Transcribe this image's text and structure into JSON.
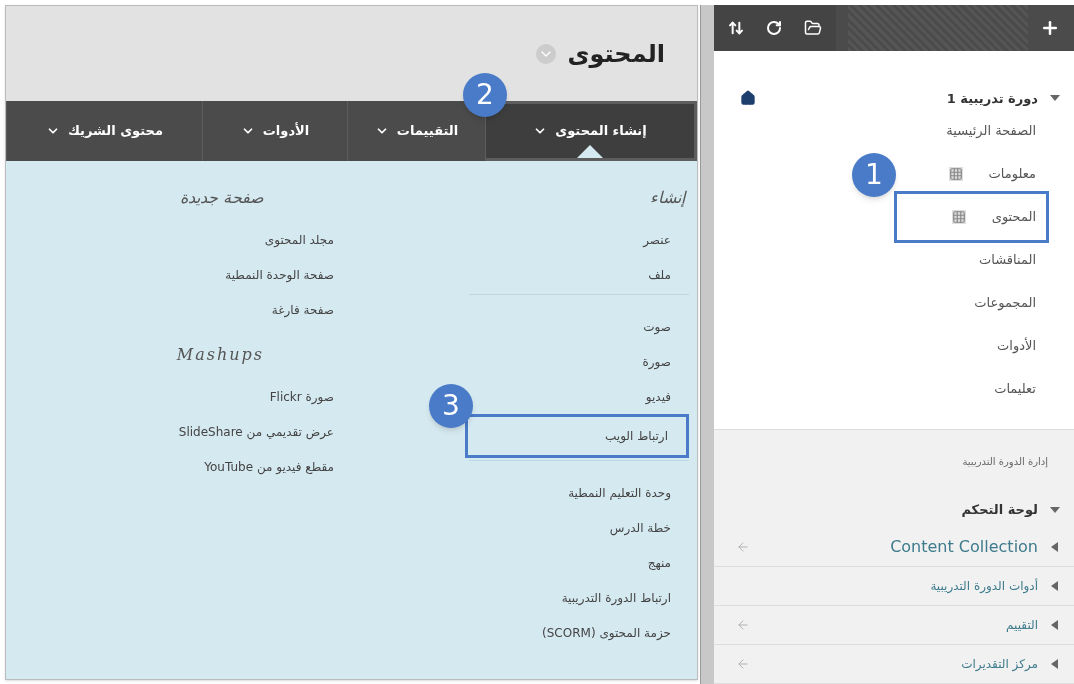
{
  "page_title": "المحتوى",
  "tabs": [
    {
      "label": "إنشاء المحتوى",
      "selected": true,
      "callout": "2"
    },
    {
      "label": "التقييمات",
      "selected": false
    },
    {
      "label": "الأدوات",
      "selected": false
    },
    {
      "label": "محتوى الشريك",
      "selected": false
    }
  ],
  "create_menu": {
    "heading": "إنشاء",
    "groups": [
      [
        {
          "label": "عنصر"
        },
        {
          "label": "ملف"
        }
      ],
      [
        {
          "label": "صوت"
        },
        {
          "label": "صورة"
        },
        {
          "label": "فيديو"
        },
        {
          "label": "ارتباط الويب",
          "callout": "3"
        }
      ],
      [
        {
          "label": "وحدة التعليم النمطية"
        },
        {
          "label": "خطة الدرس"
        },
        {
          "label": "منهج"
        },
        {
          "label": "ارتباط الدورة التدريبية"
        },
        {
          "label": "حزمة المحتوى (SCORM)"
        }
      ]
    ]
  },
  "other_menu": [
    {
      "heading": "صفحة جديدة",
      "items": [
        "مجلد المحتوى",
        "صفحة الوحدة النمطية",
        "صفحة فارغة"
      ]
    },
    {
      "heading": "Mashups",
      "items": [
        "صورة Flickr",
        "عرض تقديمي من SlideShare",
        "مقطع فيديو من YouTube"
      ]
    }
  ],
  "course_menu": {
    "title": "دورة تدريبية 1",
    "expanded": true,
    "items": [
      {
        "label": "الصفحة الرئيسية",
        "kind": "link"
      },
      {
        "label": "معلومات",
        "kind": "content_area"
      },
      {
        "label": "المحتوى",
        "kind": "content_area",
        "callout": "1"
      },
      {
        "label": "المناقشات",
        "kind": "link"
      },
      {
        "label": "المجموعات",
        "kind": "link"
      },
      {
        "label": "الأدوات",
        "kind": "link"
      },
      {
        "label": "تعليمات",
        "kind": "link"
      }
    ]
  },
  "management": {
    "heading": "إدارة الدورة التدريبية",
    "panel_title": "لوحة التحكم",
    "expanded": true,
    "items": [
      {
        "label": "Content Collection",
        "external": true
      },
      {
        "label": "أدوات الدورة التدريبية",
        "external": false
      },
      {
        "label": "التقييم",
        "external": true
      },
      {
        "label": "مركز التقديرات",
        "external": true
      }
    ]
  }
}
